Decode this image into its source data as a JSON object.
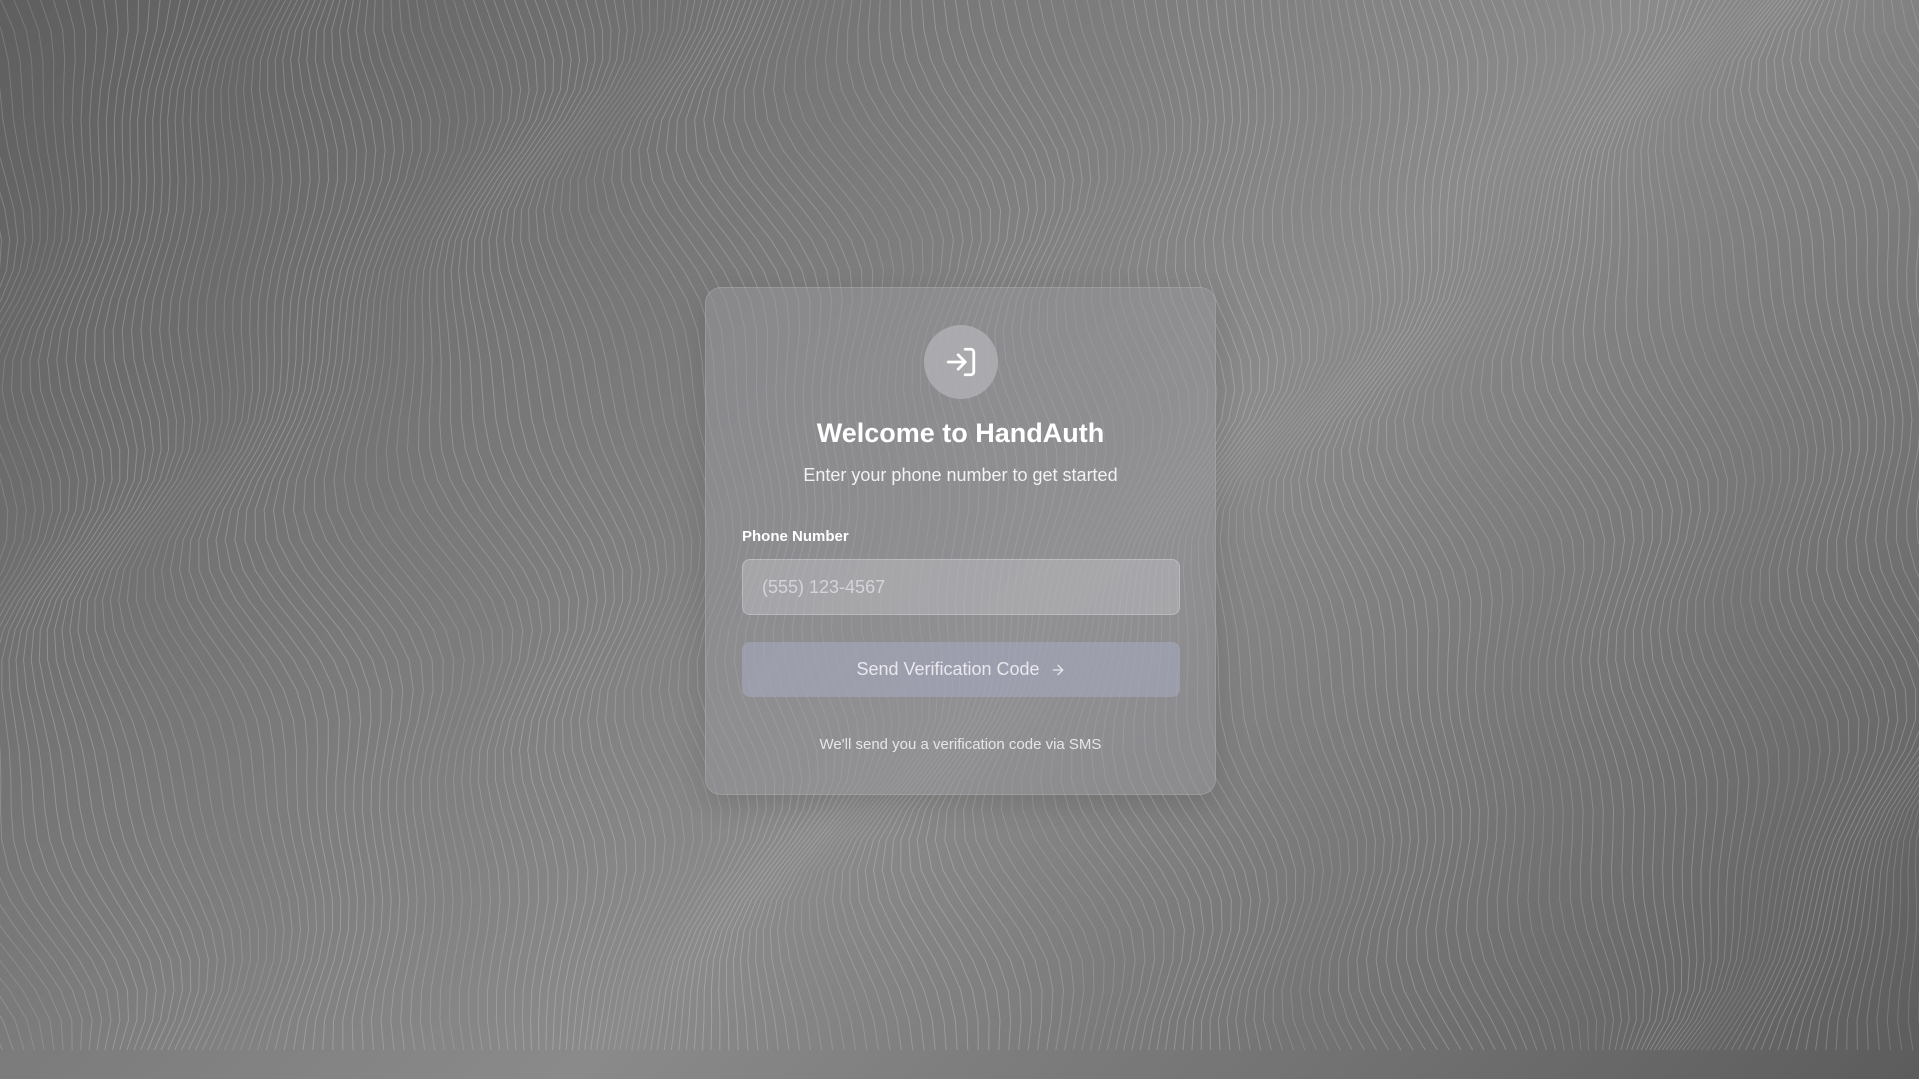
{
  "card": {
    "title": "Welcome to HandAuth",
    "subtitle": "Enter your phone number to get started",
    "logo_icon": "sign-in-icon"
  },
  "form": {
    "phone_label": "Phone Number",
    "phone_placeholder": "(555) 123-4567",
    "phone_value": "",
    "submit_label": "Send Verification Code",
    "submit_icon": "arrow-right-icon",
    "footnote": "We'll send you a verification code via SMS"
  },
  "colors": {
    "background": "#7a7a7a",
    "card": "#96969b",
    "button": "#a5a8be",
    "text": "#ffffff"
  }
}
